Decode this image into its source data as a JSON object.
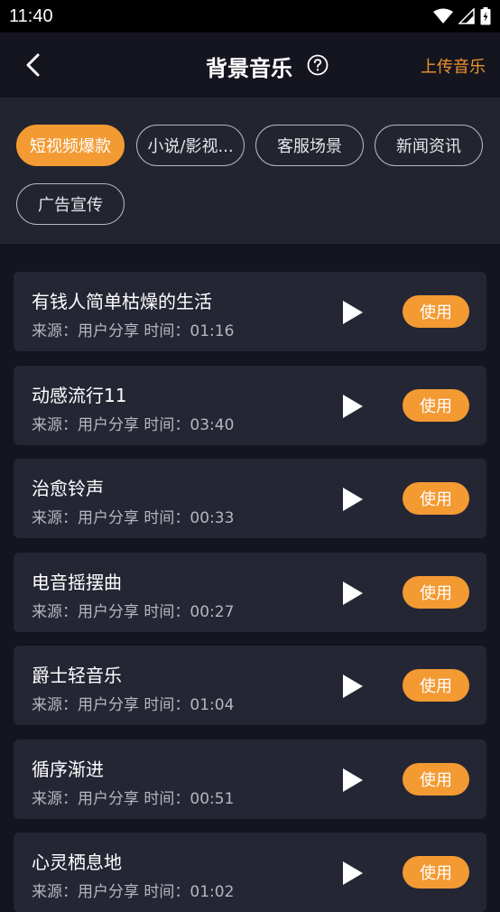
{
  "status_bar": {
    "time": "11:40"
  },
  "header": {
    "title": "背景音乐",
    "upload_label": "上传音乐"
  },
  "categories": [
    {
      "label": "短视频爆款",
      "active": true
    },
    {
      "label": "小说/影视..."
    },
    {
      "label": "客服场景"
    },
    {
      "label": "新闻资讯"
    },
    {
      "label": "广告宣传"
    }
  ],
  "tracks": [
    {
      "title": "有钱人简单枯燥的生活",
      "meta": "来源：用户分享 时间：01:16",
      "action": "使用"
    },
    {
      "title": "动感流行11",
      "meta": "来源：用户分享 时间：03:40",
      "action": "使用"
    },
    {
      "title": "治愈铃声",
      "meta": "来源：用户分享 时间：00:33",
      "action": "使用"
    },
    {
      "title": "电音摇摆曲",
      "meta": "来源：用户分享 时间：00:27",
      "action": "使用"
    },
    {
      "title": "爵士轻音乐",
      "meta": "来源：用户分享 时间：01:04",
      "action": "使用"
    },
    {
      "title": "循序渐进",
      "meta": "来源：用户分享 时间：00:51",
      "action": "使用"
    },
    {
      "title": "心灵栖息地",
      "meta": "来源：用户分享 时间：01:02",
      "action": "使用"
    }
  ],
  "colors": {
    "accent": "#f39a33",
    "background": "#14151f",
    "card": "#252634",
    "panel": "#22242f"
  }
}
